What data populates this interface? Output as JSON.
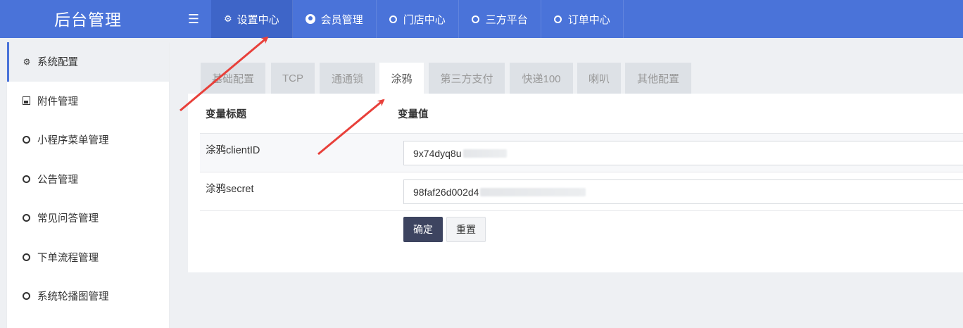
{
  "brand": "后台管理",
  "topnav": [
    {
      "label": "设置中心",
      "icon": "gears-icon",
      "active": true
    },
    {
      "label": "会员管理",
      "icon": "user-circle-icon",
      "active": false
    },
    {
      "label": "门店中心",
      "icon": "circle-icon",
      "active": false
    },
    {
      "label": "三方平台",
      "icon": "circle-icon",
      "active": false
    },
    {
      "label": "订单中心",
      "icon": "circle-icon",
      "active": false
    }
  ],
  "sidebar": {
    "items": [
      {
        "label": "系统配置",
        "icon": "gear-icon",
        "active": true
      },
      {
        "label": "附件管理",
        "icon": "image-icon",
        "active": false
      },
      {
        "label": "小程序菜单管理",
        "icon": "circle-icon",
        "active": false
      },
      {
        "label": "公告管理",
        "icon": "circle-icon",
        "active": false
      },
      {
        "label": "常见问答管理",
        "icon": "circle-icon",
        "active": false
      },
      {
        "label": "下单流程管理",
        "icon": "circle-icon",
        "active": false
      },
      {
        "label": "系统轮播图管理",
        "icon": "circle-icon",
        "active": false
      }
    ]
  },
  "tabs": [
    "基础配置",
    "TCP",
    "通通锁",
    "涂鸦",
    "第三方支付",
    "快递100",
    "喇叭",
    "其他配置"
  ],
  "active_tab": "涂鸦",
  "table": {
    "header": {
      "title": "变量标题",
      "value": "变量值"
    },
    "rows": [
      {
        "label": "涂鸦clientID",
        "value": "9x74dyq8u"
      },
      {
        "label": "涂鸦secret",
        "value": "98faf26d002d4"
      }
    ]
  },
  "buttons": {
    "submit": "确定",
    "reset": "重置"
  },
  "colors": {
    "primary": "#4a73d9",
    "dark_button": "#3d4460",
    "arrow": "#e8403a"
  }
}
